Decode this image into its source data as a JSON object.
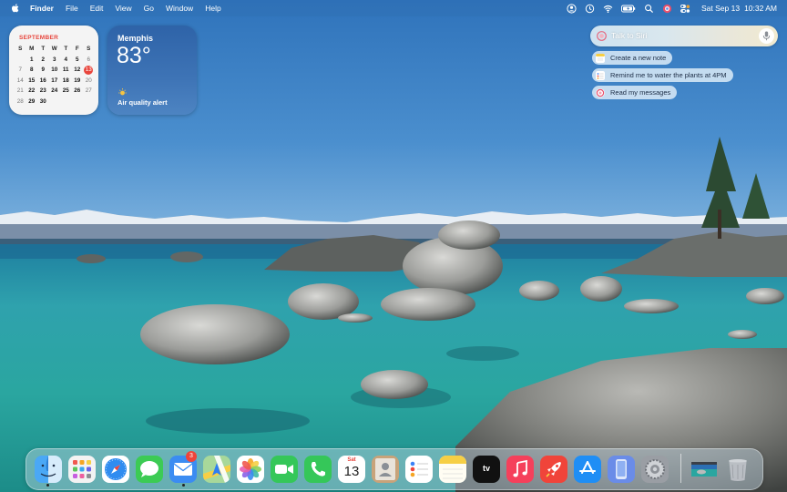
{
  "menubar": {
    "app_name": "Finder",
    "items": [
      "File",
      "Edit",
      "View",
      "Go",
      "Window",
      "Help"
    ],
    "date": "Sat Sep 13",
    "time": "10:32 AM"
  },
  "calendar_widget": {
    "month": "SEPTEMBER",
    "weekday_headers": [
      "S",
      "M",
      "T",
      "W",
      "T",
      "F",
      "S"
    ],
    "weeks": [
      [
        "",
        "1",
        "2",
        "3",
        "4",
        "5",
        "6"
      ],
      [
        "7",
        "8",
        "9",
        "10",
        "11",
        "12",
        "13"
      ],
      [
        "14",
        "15",
        "16",
        "17",
        "18",
        "19",
        "20"
      ],
      [
        "21",
        "22",
        "23",
        "24",
        "25",
        "26",
        "27"
      ],
      [
        "28",
        "29",
        "30",
        "",
        "",
        "",
        ""
      ]
    ],
    "today": "13"
  },
  "weather_widget": {
    "city": "Memphis",
    "temperature": "83°",
    "condition_icon": "sun-icon",
    "alert": "Air quality alert"
  },
  "siri": {
    "prompt": "Talk to Siri",
    "suggestions": [
      {
        "label": "Create a new note",
        "icon": "notes-icon"
      },
      {
        "label": "Remind me to water the plants at 4PM",
        "icon": "reminders-icon"
      },
      {
        "label": "Read my messages",
        "icon": "siri-icon"
      }
    ]
  },
  "dock": {
    "calendar_icon_weekday": "Sat",
    "calendar_icon_day": "13",
    "mail_badge": "3",
    "tv_label": "tv",
    "apps": [
      "finder",
      "launchpad",
      "safari",
      "messages",
      "mail",
      "maps",
      "photos",
      "facetime",
      "phone",
      "calendar",
      "contacts",
      "reminders",
      "notes",
      "tv",
      "music",
      "rocket",
      "app-store",
      "iphone-mirroring",
      "system-settings",
      "preview-window",
      "trash"
    ]
  }
}
